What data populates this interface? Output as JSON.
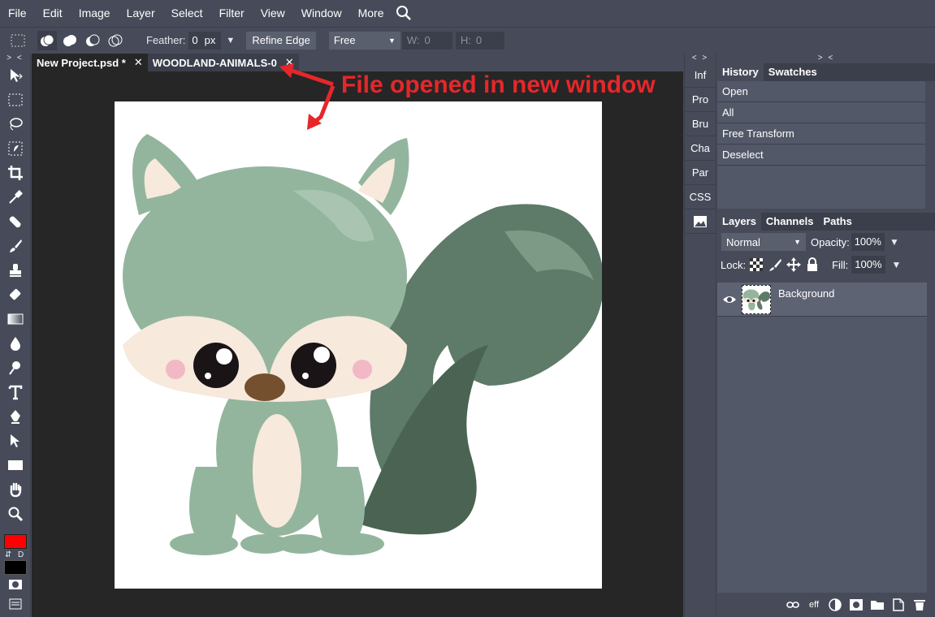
{
  "menu": [
    "File",
    "Edit",
    "Image",
    "Layer",
    "Select",
    "Filter",
    "View",
    "Window",
    "More"
  ],
  "options": {
    "feather_label": "Feather:",
    "feather_value": "0",
    "feather_unit": "px",
    "refine_edge": "Refine Edge",
    "style_value": "Free",
    "w_label": "W:",
    "w_value": "0",
    "h_label": "H:",
    "h_value": "0"
  },
  "collapse_left": "> <",
  "collapse_mid": "< >",
  "collapse_right": "> <",
  "tabs": [
    {
      "label": "New Project.psd *",
      "close": "✕"
    },
    {
      "label": "WOODLAND-ANIMALS-0",
      "close": "✕"
    }
  ],
  "annotation": "File opened in new window",
  "side_panels": [
    "Inf",
    "Pro",
    "Bru",
    "Cha",
    "Par",
    "CSS"
  ],
  "history": {
    "tab_history": "History",
    "tab_swatches": "Swatches",
    "items": [
      "Open",
      "All",
      "Free Transform",
      "Deselect"
    ]
  },
  "layers": {
    "tab_layers": "Layers",
    "tab_channels": "Channels",
    "tab_paths": "Paths",
    "blend_mode": "Normal",
    "opacity_label": "Opacity:",
    "opacity_value": "100%",
    "lock_label": "Lock:",
    "fill_label": "Fill:",
    "fill_value": "100%",
    "layer_name": "Background",
    "footer_eff": "eff"
  },
  "colors": {
    "foreground": "#ff0000",
    "background": "#000000",
    "annotation": "#e6272a"
  },
  "swap_label": "⇵",
  "default_label": "D"
}
